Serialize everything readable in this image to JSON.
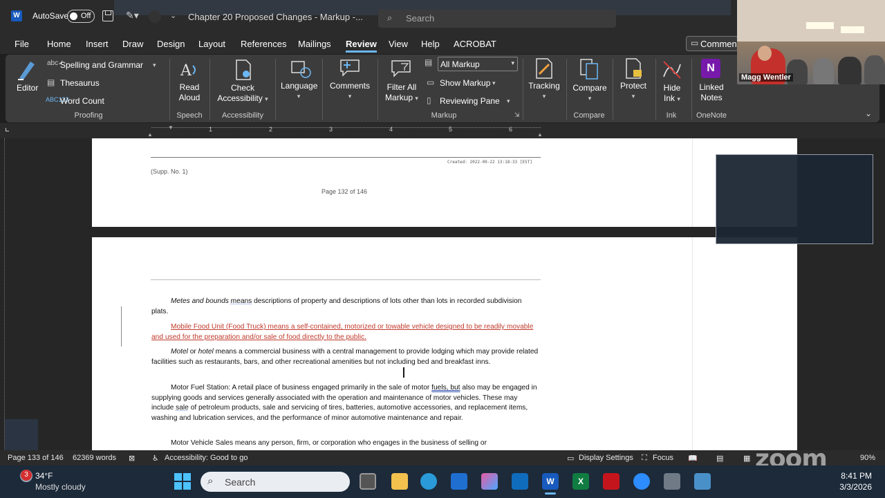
{
  "titlebar": {
    "autosave_label": "AutoSave",
    "autosave_state": "Off",
    "doc_title": "Chapter 20 Proposed Changes - Markup -...",
    "search_placeholder": "Search"
  },
  "menu": {
    "tabs": [
      "File",
      "Home",
      "Insert",
      "Draw",
      "Design",
      "Layout",
      "References",
      "Mailings",
      "Review",
      "View",
      "Help",
      "ACROBAT"
    ],
    "active": "Review",
    "comments_button": "Commen"
  },
  "ribbon": {
    "editor": "Editor",
    "spelling": "Spelling and Grammar",
    "thesaurus": "Thesaurus",
    "word_count": "Word Count",
    "proofing": "Proofing",
    "read_aloud_1": "Read",
    "read_aloud_2": "Aloud",
    "speech": "Speech",
    "check_1": "Check",
    "check_2": "Accessibility",
    "accessibility": "Accessibility",
    "language": "Language",
    "comments": "Comments",
    "filter_1": "Filter All",
    "filter_2": "Markup",
    "all_markup": "All Markup",
    "show_markup": "Show Markup",
    "reviewing_pane": "Reviewing Pane",
    "markup": "Markup",
    "tracking": "Tracking",
    "compare_btn": "Compare",
    "compare_group": "Compare",
    "protect": "Protect",
    "hide_1": "Hide",
    "hide_2": "Ink",
    "ink": "Ink",
    "linked_1": "Linked",
    "linked_2": "Notes",
    "onenote": "OneNote"
  },
  "video": {
    "participant": "Magg Wentler"
  },
  "ruler_numbers": [
    "1",
    "2",
    "3",
    "4",
    "5",
    "6"
  ],
  "page1": {
    "created": "Created: 2022-09-22 13:18:33 [EST]",
    "supp": "(Supp. No. 1)",
    "page_number": "Page 132 of 146"
  },
  "page2": {
    "p1_italic": "Metes and bounds",
    "p1_word": "means",
    "p1_rest": "descriptions of property and descriptions of lots other than lots in recorded subdivision plats.",
    "p2": "Mobile Food Unit (Food Truck) means a self-contained, motorized or towable vehicle designed to be readily movable and used for the preparation and/or sale of food directly to the public.",
    "p3_italic1": "Motel",
    "p3_or": "or",
    "p3_italic2": "hotel",
    "p3_rest": "means a commercial business with a central management to provide lodging which may provide related facilities such as restaurants, bars, and other recreational amenities but not including bed and breakfast inns.",
    "p4_a": "Motor Fuel Station: A retail place of business engaged primarily in the sale of motor",
    "p4_fuels": "fuels, but",
    "p4_b": "also may be engaged in supplying goods and services generally associated with the operation and maintenance of motor vehicles. These may include",
    "p4_sale": "sale",
    "p4_c": "of petroleum products, sale and servicing of tires, batteries, automotive accessories, and replacement items, washing and lubrication services, and the performance of minor automotive maintenance and repair.",
    "p5": "Motor Vehicle Sales means any person, firm, or corporation who engages in the business of selling or"
  },
  "status": {
    "page": "Page 133 of 146",
    "words": "62369 words",
    "accessibility": "Accessibility: Good to go",
    "display_settings": "Display Settings",
    "focus": "Focus",
    "zoom": "90%",
    "zoom_logo": "zoom"
  },
  "taskbar": {
    "weather_badge": "3",
    "temp": "34°F",
    "condition": "Mostly cloudy",
    "search": "Search",
    "time": "8:41 PM",
    "date": "3/3/2026"
  }
}
